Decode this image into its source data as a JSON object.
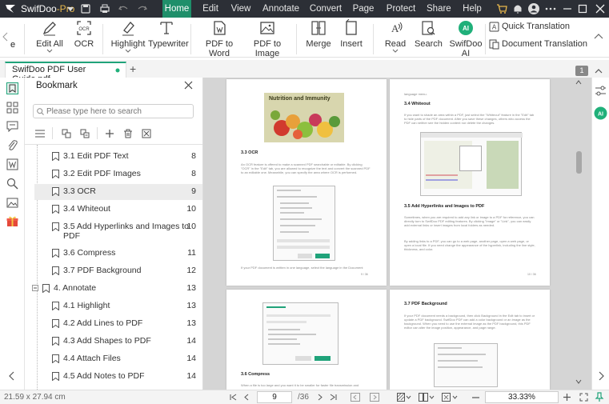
{
  "titlebar": {
    "app_name": "SwifDoo",
    "app_edition": "-Pro",
    "menus": [
      "Home",
      "Edit",
      "View",
      "Annotate",
      "Convert",
      "Page",
      "Protect",
      "Share",
      "Help"
    ],
    "active_menu": "Home"
  },
  "ribbon": {
    "partial_label": "e",
    "edit_all": "Edit All",
    "ocr": "OCR",
    "highlight": "Highlight",
    "typewriter": "Typewriter",
    "pdf_to_word": "PDF to Word",
    "pdf_to_image": "PDF to Image",
    "merge": "Merge",
    "insert": "Insert",
    "read": "Read",
    "search": "Search",
    "swifdoo_ai": "SwifDoo AI",
    "quick_translation": "Quick Translation",
    "document_translation": "Document Translation"
  },
  "tabs": {
    "doc_name": "SwifDoo PDF User Guide.pdf",
    "add_tab": "+",
    "page_badge": "1"
  },
  "bookmark_panel": {
    "title": "Bookmark",
    "search_placeholder": "Please type here to search",
    "items": [
      {
        "label": "3.1 Edit PDF Text",
        "page": "8"
      },
      {
        "label": "3.2 Edit PDF Images",
        "page": "8"
      },
      {
        "label": "3.3 OCR",
        "page": "9"
      },
      {
        "label": "3.4 Whiteout",
        "page": "10"
      },
      {
        "label": "3.5 Add Hyperlinks and Images to",
        "label2": "PDF",
        "page": "10"
      },
      {
        "label": "3.6 Compress",
        "page": "11"
      },
      {
        "label": "3.7 PDF Background",
        "page": "12"
      },
      {
        "label": "4. Annotate",
        "page": "13"
      },
      {
        "label": "4.1 Highlight",
        "page": "13"
      },
      {
        "label": "4.2 Add Lines to PDF",
        "page": "13"
      },
      {
        "label": "4.3 Add Shapes to PDF",
        "page": "14"
      },
      {
        "label": "4.4 Attach Files",
        "page": "14"
      },
      {
        "label": "4.5 Add Notes to PDF",
        "page": "14"
      }
    ]
  },
  "pages": {
    "p1_heading": "3.3 OCR",
    "p1_img_title": "Nutrition and Immunity",
    "p1_para": "An OCR feature is offered to make a scanned PDF searchable or editable. By clicking \"OCR\" in the \"Edit\" tab, you are allowed to recognize the text and convert the scanned PDF to an editable one. Meanwhile, you can specify the area where OCR is performed.",
    "p1_foot": "If your PDF document is written in one language, select the language in the Document",
    "p1_num": "9 / 36",
    "p2_top": "language menu.",
    "p2_heading": "3.4 Whiteout",
    "p2_para": "If you want to shade an area within a PDF, just select the \"Whiteout\" feature in the \"Edit\" tab to hide parts of the PDF document. After you save these changes, others who access the PDF can neither see the hidden content nor delete the changes.",
    "p2_heading2": "3.5 Add Hyperlinks and Images to PDF",
    "p2_para2": "Sometimes, when you are required to add any link or image to a PDF for reference, you can directly turn to SwifDoo PDF editing features. By clicking \"Image\" or \"Link\", you can easily add external links or insert images from local folders as needed.",
    "p2_para3": "By adding links to a PDF, you can go to a web page, another page, open a web page, or open a local file. If you need change the appearance of the hyperlink, including the line style, thickness, and color.",
    "p2_num": "10 / 36",
    "p3_heading": "3.6 Compress",
    "p3_foot": "When a file is too large and you want it to be smaller for faster file transmission and",
    "p4_heading": "3.7 PDF Background",
    "p4_para": "If your PDF document needs a background, then click Background in the Edit tab to insert or update a PDF background. SwifDoo PDF can add a color background or an image as the background. When you need to use the external image as the PDF background, this PDF editor can alter the image position, appearance, and page range."
  },
  "status": {
    "page_size": "21.59 x 27.94 cm",
    "current_page": "9",
    "total_pages": "/36",
    "zoom": "33.33%"
  },
  "colors": {
    "accent": "#1f8f6a",
    "ai_badge": "#20b07a",
    "titlebar": "#2c2f36"
  }
}
